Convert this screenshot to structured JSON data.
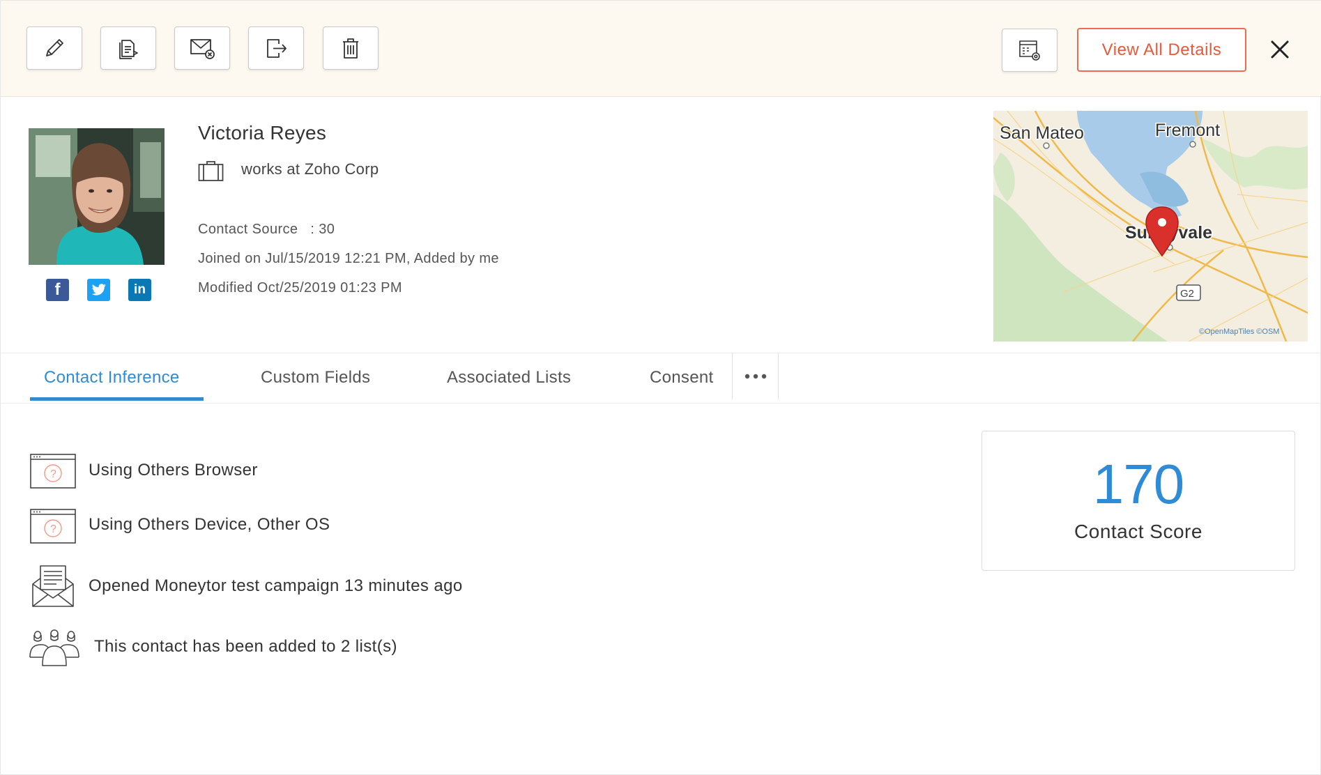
{
  "toolbar": {
    "buttons": [
      {
        "name": "edit",
        "icon": "pencil-icon"
      },
      {
        "name": "notes",
        "icon": "document-icon"
      },
      {
        "name": "unsubscribe",
        "icon": "mail-cancel-icon"
      },
      {
        "name": "export",
        "icon": "export-icon"
      },
      {
        "name": "delete",
        "icon": "trash-icon"
      }
    ],
    "settings_icon": "table-settings-icon",
    "view_all_label": "View All Details",
    "close_icon": "close-icon"
  },
  "contact": {
    "name": "Victoria Reyes",
    "company": "works at Zoho Corp",
    "contact_source": "Contact Source   : 30",
    "joined": "Joined on Jul/15/2019 12:21 PM, Added by me",
    "modified": "Modified Oct/25/2019 01:23 PM",
    "socials": {
      "facebook": "f",
      "linkedin": "in"
    }
  },
  "map": {
    "labels": [
      "San Mateo",
      "Fremont",
      "Sunnyvale",
      "G2"
    ],
    "attribution": "©OpenMapTiles ©OSM"
  },
  "tabs": [
    {
      "label": "Contact Inference",
      "active": true
    },
    {
      "label": "Custom Fields",
      "active": false
    },
    {
      "label": "Associated Lists",
      "active": false
    },
    {
      "label": "Consent",
      "active": false
    }
  ],
  "inferences": [
    {
      "text": "Using Others Browser",
      "icon": "unknown-browser-icon"
    },
    {
      "text": "Using Others Device, Other OS",
      "icon": "unknown-device-icon"
    },
    {
      "text": "Opened Moneytor test campaign 13 minutes ago",
      "icon": "opened-email-icon"
    },
    {
      "text": "This contact has been added to 2 list(s)",
      "icon": "contact-group-icon"
    }
  ],
  "score": {
    "value": "170",
    "label": "Contact Score"
  },
  "colors": {
    "accent": "#2f8bd6",
    "view_all": "#e8583b",
    "toolbar_bg": "#fdf9f0"
  }
}
